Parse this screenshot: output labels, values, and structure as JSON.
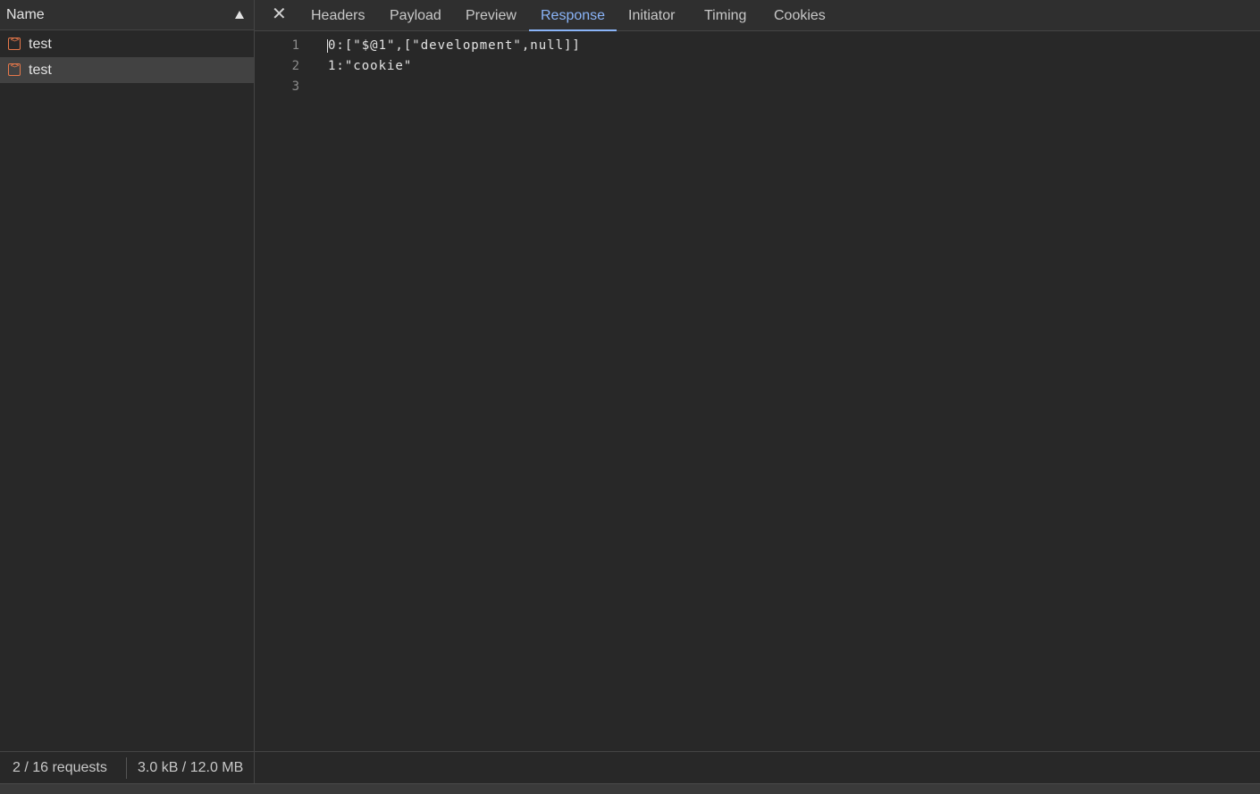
{
  "requests_panel": {
    "header_label": "Name",
    "items": [
      {
        "label": "test",
        "icon": "code-doc-icon",
        "selected": false
      },
      {
        "label": "test",
        "icon": "code-doc-icon",
        "selected": true
      }
    ],
    "status": {
      "requests": "2 / 16 requests",
      "transfer": "3.0 kB / 12.0 MB"
    }
  },
  "detail_panel": {
    "close_glyph": "✕",
    "tabs": [
      {
        "label": "Headers",
        "active": false
      },
      {
        "label": "Payload",
        "active": false
      },
      {
        "label": "Preview",
        "active": false
      },
      {
        "label": "Response",
        "active": true
      },
      {
        "label": "Initiator",
        "active": false
      },
      {
        "label": "Timing",
        "active": false
      },
      {
        "label": "Cookies",
        "active": false
      }
    ],
    "response_lines": [
      {
        "number": "1",
        "text": "0:[\"$@1\",[\"development\",null]]"
      },
      {
        "number": "2",
        "text": "1:\"cookie\""
      },
      {
        "number": "3",
        "text": ""
      }
    ]
  },
  "colors": {
    "accent": "#8ab4f8",
    "icon_orange": "#e8784a",
    "background": "#282828"
  }
}
